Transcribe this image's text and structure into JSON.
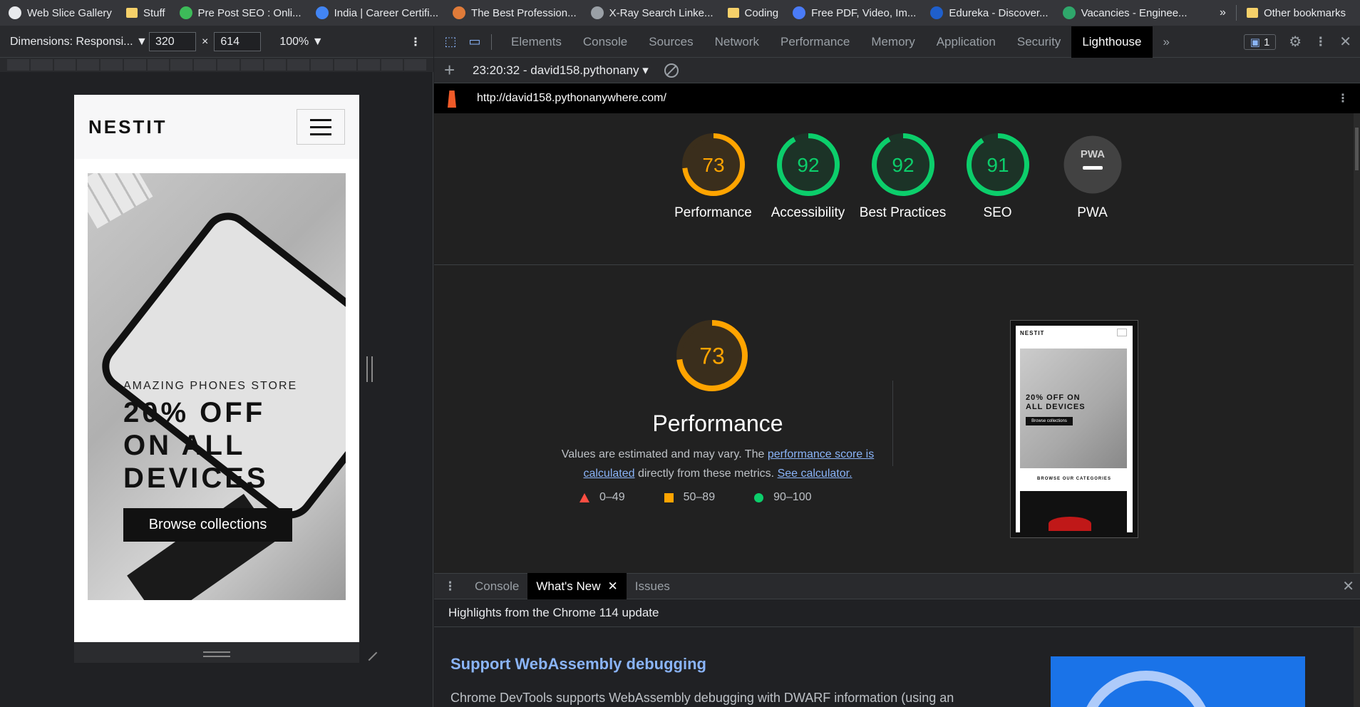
{
  "bookmarks": {
    "items": [
      {
        "label": "Web Slice Gallery",
        "color": "#e8eaed"
      },
      {
        "label": "Stuff",
        "color": "#f6d16a"
      },
      {
        "label": "Pre Post SEO : Onli...",
        "color": "#3dbb59"
      },
      {
        "label": "India | Career Certifi...",
        "color": "#4285f4"
      },
      {
        "label": "The Best Profession...",
        "color": "#e07b39"
      },
      {
        "label": "X-Ray Search Linke...",
        "color": "#9aa0a6"
      },
      {
        "label": "Coding",
        "color": "#f6d16a"
      },
      {
        "label": "Free PDF, Video, Im...",
        "color": "#4a7bf7"
      },
      {
        "label": "Edureka - Discover...",
        "color": "#1f5fcc"
      },
      {
        "label": "Vacancies - Enginee...",
        "color": "#2fa76b"
      }
    ],
    "more": "»",
    "other": "Other bookmarks"
  },
  "device_toolbar": {
    "dimensions_label": "Dimensions: Responsi...",
    "width": "320",
    "height": "614",
    "x_sep": "×",
    "zoom": "100%",
    "menu": "⋮"
  },
  "site": {
    "brand": "NESTIT",
    "hero_subtitle": "AMAZING PHONES STORE",
    "hero_title_line1": "20% OFF",
    "hero_title_line2": "ON ALL",
    "hero_title_line3": "DEVICES",
    "hero_button": "Browse collections"
  },
  "devtools": {
    "tabs": [
      "Elements",
      "Console",
      "Sources",
      "Network",
      "Performance",
      "Memory",
      "Application",
      "Security",
      "Lighthouse"
    ],
    "active_tab": "Lighthouse",
    "more_tabs": "»",
    "issues_count": "1"
  },
  "lighthouse": {
    "session": "23:20:32 - david158.pythonany",
    "url": "http://david158.pythonanywhere.com/",
    "categories": [
      {
        "label": "Performance",
        "score": "73",
        "value": 73,
        "color": "#ffa400",
        "fill": "#3a2e1c"
      },
      {
        "label": "Accessibility",
        "score": "92",
        "value": 92,
        "color": "#0cce6b",
        "fill": "#1c3327"
      },
      {
        "label": "Best Practices",
        "score": "92",
        "value": 92,
        "color": "#0cce6b",
        "fill": "#1c3327"
      },
      {
        "label": "SEO",
        "score": "91",
        "value": 91,
        "color": "#0cce6b",
        "fill": "#1c3327"
      },
      {
        "label": "PWA",
        "score": "PWA",
        "value": 0,
        "color": "#9aa0a6",
        "fill": "#424242"
      }
    ],
    "perf": {
      "score": "73",
      "value": 73,
      "title": "Performance",
      "desc_pre": "Values are estimated and may vary. The ",
      "link1": "performance score is calculated",
      "desc_mid": " directly from these metrics. ",
      "link2": "See calculator."
    },
    "legend": {
      "poor": "0–49",
      "average": "50–89",
      "good": "90–100"
    },
    "thumbnail": {
      "brand": "NESTIT",
      "hero": "20% OFF ON ALL DEVICES",
      "button": "Browse collections",
      "section": "BROWSE OUR CATEGORIES"
    }
  },
  "drawer": {
    "tabs": [
      "Console",
      "What's New",
      "Issues"
    ],
    "active": "What's New",
    "headline": "Highlights from the Chrome 114 update",
    "feature_title": "Support WebAssembly debugging",
    "feature_body": "Chrome DevTools supports WebAssembly debugging with DWARF information (using an"
  }
}
